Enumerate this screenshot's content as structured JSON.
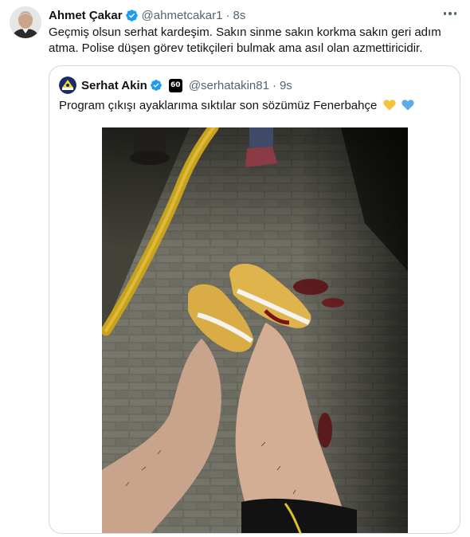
{
  "tweet": {
    "author_name": "Ahmet Çakar",
    "handle": "@ahmetcakar1",
    "separator": "·",
    "time": "8s",
    "text": "Geçmiş olsun serhat kardeşim. Sakın sinme sakın korkma sakın geri adım atma. Polise düşen görev tetikçileri bulmak ama asıl olan azmettiricidir."
  },
  "quoted": {
    "author_name": "Serhat Akin",
    "badge_text": "60",
    "handle": "@serhatakin81",
    "separator": "·",
    "time": "9s",
    "text": "Program çıkışı ayaklarıma sıktılar son sözümüz Fenerbahçe",
    "hearts": [
      "yellow-heart-icon",
      "blue-heart-icon"
    ]
  },
  "colors": {
    "verified": "#1d9bf0",
    "muted": "#536471",
    "text": "#0f1419",
    "border": "#cfd9de",
    "yellow_heart": "#f5c33b",
    "blue_heart": "#5dadec"
  }
}
